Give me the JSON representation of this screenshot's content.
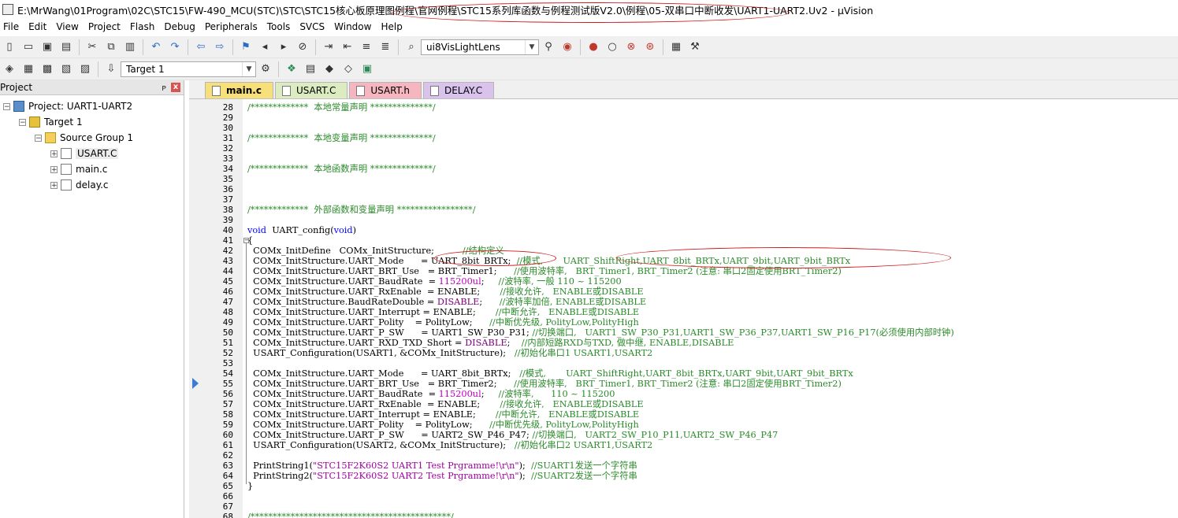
{
  "window": {
    "title": "E:\\MrWang\\01Program\\02C\\STC15\\FW-490_MCU(STC)\\STC\\STC15核心板原理图例程\\官网例程\\STC15系列库函数与例程测试版V2.0\\例程\\05-双串口中断收发\\UART1-UART2.Uv2 - µVision"
  },
  "menu": [
    "File",
    "Edit",
    "View",
    "Project",
    "Flash",
    "Debug",
    "Peripherals",
    "Tools",
    "SVCS",
    "Window",
    "Help"
  ],
  "toolbar1": {
    "icons": [
      "new-file-icon",
      "open-folder-icon",
      "save-icon",
      "save-all-icon",
      "cut-icon",
      "copy-icon",
      "paste-icon",
      "undo-icon",
      "redo-icon",
      "nav-back-icon",
      "nav-forward-icon",
      "bookmark-icon",
      "bookmark-prev-icon",
      "bookmark-next-icon",
      "bookmark-clear-icon",
      "indent-icon",
      "outdent-icon",
      "comment-icon",
      "uncomment-icon"
    ],
    "find_value": "ui8VisLightLens",
    "tail_icons": [
      "find-in-files-icon",
      "incremental-find-icon",
      "debug-session-icon",
      "breakpoint-insert-icon",
      "breakpoint-disable-icon",
      "breakpoint-kill-icon",
      "breakpoint-kill-all-icon",
      "window-layout-icon",
      "configure-icon"
    ]
  },
  "toolbar2": {
    "icons": [
      "translate-icon",
      "build-icon",
      "rebuild-icon",
      "batch-build-icon",
      "stop-build-icon",
      "download-icon"
    ],
    "target_value": "Target 1",
    "tail_icons": [
      "target-options-icon",
      "manage-components-icon",
      "file-extensions-icon",
      "select-packs-icon",
      "manage-runtime-icon",
      "pack-installer-icon"
    ]
  },
  "project_panel": {
    "title": "Project",
    "pin": "ᴘ",
    "close": "x",
    "tree": [
      {
        "label": "Project: UART1-UART2",
        "level": 0,
        "expander": "−",
        "icon": "project"
      },
      {
        "label": "Target 1",
        "level": 1,
        "expander": "−",
        "icon": "target"
      },
      {
        "label": "Source Group 1",
        "level": 2,
        "expander": "−",
        "icon": "folder"
      },
      {
        "label": "USART.C",
        "level": 3,
        "expander": "+",
        "icon": "file",
        "selected": true
      },
      {
        "label": "main.c",
        "level": 3,
        "expander": "+",
        "icon": "file"
      },
      {
        "label": "delay.c",
        "level": 3,
        "expander": "+",
        "icon": "file"
      }
    ]
  },
  "tabs": [
    {
      "label": "main.c",
      "color": "#f7e07a",
      "active": true
    },
    {
      "label": "USART.C",
      "color": "#dcecc0"
    },
    {
      "label": "USART.h",
      "color": "#f5b6c0"
    },
    {
      "label": "DELAY.C",
      "color": "#d9c3ec"
    }
  ],
  "colors": {
    "comment": "#2a8a2a",
    "keyword": "#0000ff",
    "number": "#c000c0",
    "macro": "#800080",
    "annotation": "#d11a1a",
    "margin": "#f0f0f0"
  },
  "code": [
    {
      "n": "28",
      "segs": [
        [
          "cm",
          "/*************  本地常量声明 **************/"
        ]
      ]
    },
    {
      "n": "29",
      "segs": []
    },
    {
      "n": "30",
      "segs": []
    },
    {
      "n": "31",
      "segs": [
        [
          "cm",
          "/*************  本地变量声明 **************/"
        ]
      ]
    },
    {
      "n": "32",
      "segs": []
    },
    {
      "n": "33",
      "segs": []
    },
    {
      "n": "34",
      "segs": [
        [
          "cm",
          "/*************  本地函数声明 **************/"
        ]
      ]
    },
    {
      "n": "35",
      "segs": []
    },
    {
      "n": "36",
      "segs": []
    },
    {
      "n": "37",
      "segs": []
    },
    {
      "n": "38",
      "segs": [
        [
          "cm",
          "/*************  外部函数和变量声明 *****************/"
        ]
      ]
    },
    {
      "n": "39",
      "segs": []
    },
    {
      "n": "40",
      "segs": [
        [
          "kw",
          "void"
        ],
        [
          "pl",
          "  UART_config("
        ],
        [
          "kw",
          "void"
        ],
        [
          "pl",
          ")"
        ]
      ]
    },
    {
      "n": "41",
      "segs": [
        [
          "pl",
          "{"
        ]
      ]
    },
    {
      "n": "42",
      "segs": [
        [
          "pl",
          "  COMx_InitDefine   COMx_InitStructure;          "
        ],
        [
          "cm",
          "//结构定义"
        ]
      ]
    },
    {
      "n": "43",
      "segs": [
        [
          "pl",
          "  COMx_InitStructure.UART_Mode      = UART_8bit_BRTx;  "
        ],
        [
          "cm",
          "//模式,       UART_ShiftRight,UART_8bit_BRTx,UART_9bit,UART_9bit_BRTx"
        ]
      ]
    },
    {
      "n": "44",
      "segs": [
        [
          "pl",
          "  COMx_InitStructure.UART_BRT_Use   = BRT_Timer1;      "
        ],
        [
          "cm",
          "//使用波特率,   BRT_Timer1, BRT_Timer2 (注意: 串口2固定使用BRT_Timer2)"
        ]
      ]
    },
    {
      "n": "45",
      "segs": [
        [
          "pl",
          "  COMx_InitStructure.UART_BaudRate  = "
        ],
        [
          "num",
          "115200ul"
        ],
        [
          "pl",
          ";     "
        ],
        [
          "cm",
          "//波特率, 一般 110 ~ 115200"
        ]
      ]
    },
    {
      "n": "46",
      "segs": [
        [
          "pl",
          "  COMx_InitStructure.UART_RxEnable  = ENABLE;       "
        ],
        [
          "cm",
          "//接收允许,   ENABLE或DISABLE"
        ]
      ]
    },
    {
      "n": "47",
      "segs": [
        [
          "pl",
          "  COMx_InitStructure.BaudRateDouble = "
        ],
        [
          "mac",
          "DISABLE"
        ],
        [
          "pl",
          ";      "
        ],
        [
          "cm",
          "//波特率加倍, ENABLE或DISABLE"
        ]
      ]
    },
    {
      "n": "48",
      "segs": [
        [
          "pl",
          "  COMx_InitStructure.UART_Interrupt = ENABLE;       "
        ],
        [
          "cm",
          "//中断允许,   ENABLE或DISABLE"
        ]
      ]
    },
    {
      "n": "49",
      "segs": [
        [
          "pl",
          "  COMx_InitStructure.UART_Polity    = PolityLow;      "
        ],
        [
          "cm",
          "//中断优先级, PolityLow,PolityHigh"
        ]
      ]
    },
    {
      "n": "50",
      "segs": [
        [
          "pl",
          "  COMx_InitStructure.UART_P_SW      = UART1_SW_P30_P31; "
        ],
        [
          "cm",
          "//切换端口,   UART1_SW_P30_P31,UART1_SW_P36_P37,UART1_SW_P16_P17(必须使用内部时钟)"
        ]
      ]
    },
    {
      "n": "51",
      "segs": [
        [
          "pl",
          "  COMx_InitStructure.UART_RXD_TXD_Short = "
        ],
        [
          "mac",
          "DISABLE"
        ],
        [
          "pl",
          ";    "
        ],
        [
          "cm",
          "//内部短路RXD与TXD, 做中继, ENABLE,DISABLE"
        ]
      ]
    },
    {
      "n": "52",
      "segs": [
        [
          "pl",
          "  USART_Configuration(USART1, &COMx_InitStructure);   "
        ],
        [
          "cm",
          "//初始化串口1 USART1,USART2"
        ]
      ]
    },
    {
      "n": "53",
      "segs": []
    },
    {
      "n": "54",
      "segs": [
        [
          "pl",
          "  COMx_InitStructure.UART_Mode      = UART_8bit_BRTx;   "
        ],
        [
          "cm",
          "//模式,       UART_ShiftRight,UART_8bit_BRTx,UART_9bit,UART_9bit_BRTx"
        ]
      ]
    },
    {
      "n": "55",
      "segs": [
        [
          "pl",
          "  COMx_InitStructure.UART_BRT_Use   = BRT_Timer2;      "
        ],
        [
          "cm",
          "//使用波特率,   BRT_Timer1, BRT_Timer2 (注意: 串口2固定使用BRT_Timer2)"
        ]
      ]
    },
    {
      "n": "56",
      "segs": [
        [
          "pl",
          "  COMx_InitStructure.UART_BaudRate  = "
        ],
        [
          "num",
          "115200ul"
        ],
        [
          "pl",
          ";     "
        ],
        [
          "cm",
          "//波特率,      110 ~ 115200"
        ]
      ]
    },
    {
      "n": "57",
      "segs": [
        [
          "pl",
          "  COMx_InitStructure.UART_RxEnable  = ENABLE;       "
        ],
        [
          "cm",
          "//接收允许,   ENABLE或DISABLE"
        ]
      ]
    },
    {
      "n": "58",
      "segs": [
        [
          "pl",
          "  COMx_InitStructure.UART_Interrupt = ENABLE;       "
        ],
        [
          "cm",
          "//中断允许,   ENABLE或DISABLE"
        ]
      ]
    },
    {
      "n": "59",
      "segs": [
        [
          "pl",
          "  COMx_InitStructure.UART_Polity    = PolityLow;      "
        ],
        [
          "cm",
          "//中断优先级, PolityLow,PolityHigh"
        ]
      ]
    },
    {
      "n": "60",
      "segs": [
        [
          "pl",
          "  COMx_InitStructure.UART_P_SW      = UART2_SW_P46_P47; "
        ],
        [
          "cm",
          "//切换端口,   UART2_SW_P10_P11,UART2_SW_P46_P47"
        ]
      ]
    },
    {
      "n": "61",
      "segs": [
        [
          "pl",
          "  USART_Configuration(USART2, &COMx_InitStructure);   "
        ],
        [
          "cm",
          "//初始化串口2 USART1,USART2"
        ]
      ]
    },
    {
      "n": "62",
      "segs": []
    },
    {
      "n": "63",
      "segs": [
        [
          "pl",
          "  PrintString1("
        ],
        [
          "str",
          "\"STC15F2K60S2 UART1 Test Prgramme!\\r\\n\""
        ],
        [
          "pl",
          ");  "
        ],
        [
          "cm",
          "//SUART1发送一个字符串"
        ]
      ]
    },
    {
      "n": "64",
      "segs": [
        [
          "pl",
          "  PrintString2("
        ],
        [
          "str",
          "\"STC15F2K60S2 UART2 Test Prgramme!\\r\\n\""
        ],
        [
          "pl",
          ");  "
        ],
        [
          "cm",
          "//SUART2发送一个字符串"
        ]
      ]
    },
    {
      "n": "65",
      "segs": [
        [
          "pl",
          "}"
        ]
      ]
    },
    {
      "n": "66",
      "segs": []
    },
    {
      "n": "67",
      "segs": []
    },
    {
      "n": "68",
      "segs": [
        [
          "cm",
          "/*********************************************/"
        ]
      ]
    }
  ]
}
